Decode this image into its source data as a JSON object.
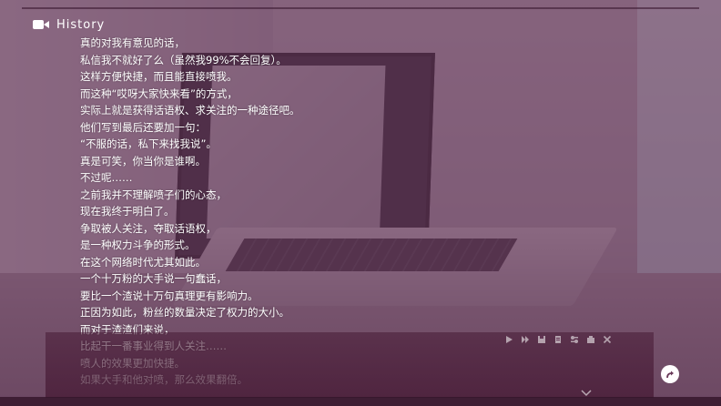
{
  "history": {
    "title": "History",
    "title_icon": "video-camera-icon",
    "lines": [
      "真的对我有意见的话，",
      "私信我不就好了么（虽然我99%不会回复）。",
      "这样方便快捷，而且能直接喷我。",
      "而这种“哎呀大家快来看”的方式，",
      "实际上就是获得话语权、求关注的一种途径吧。",
      "他们写到最后还要加一句：",
      "“不服的话，私下来找我说”。",
      "真是可笑，你当你是谁啊。",
      "不过呢……",
      "之前我并不理解喷子们的心态，",
      "现在我终于明白了。",
      "争取被人关注，夺取话语权，",
      "是一种权力斗争的形式。",
      "在这个网络时代尤其如此。",
      "一个十万粉的大手说一句蠢话，",
      "要比一个渣说十万句真理更有影响力。",
      "正因为如此，粉丝的数量决定了权力的大小。",
      "而对于渣渣们来说，",
      "比起干一番事业得到人关注……",
      "喷人的效果更加快捷。",
      "如果大手和他对喷，那么效果翻倍。"
    ]
  },
  "toolbar": {
    "icons": [
      "play-icon",
      "skip-icon",
      "save-icon",
      "load-icon",
      "settings-icon",
      "hide-window-icon",
      "close-icon"
    ]
  },
  "return_button": {
    "icon": "return-arrow-icon"
  },
  "colors": {
    "overlay": "#623054",
    "text": "#ffffff"
  }
}
